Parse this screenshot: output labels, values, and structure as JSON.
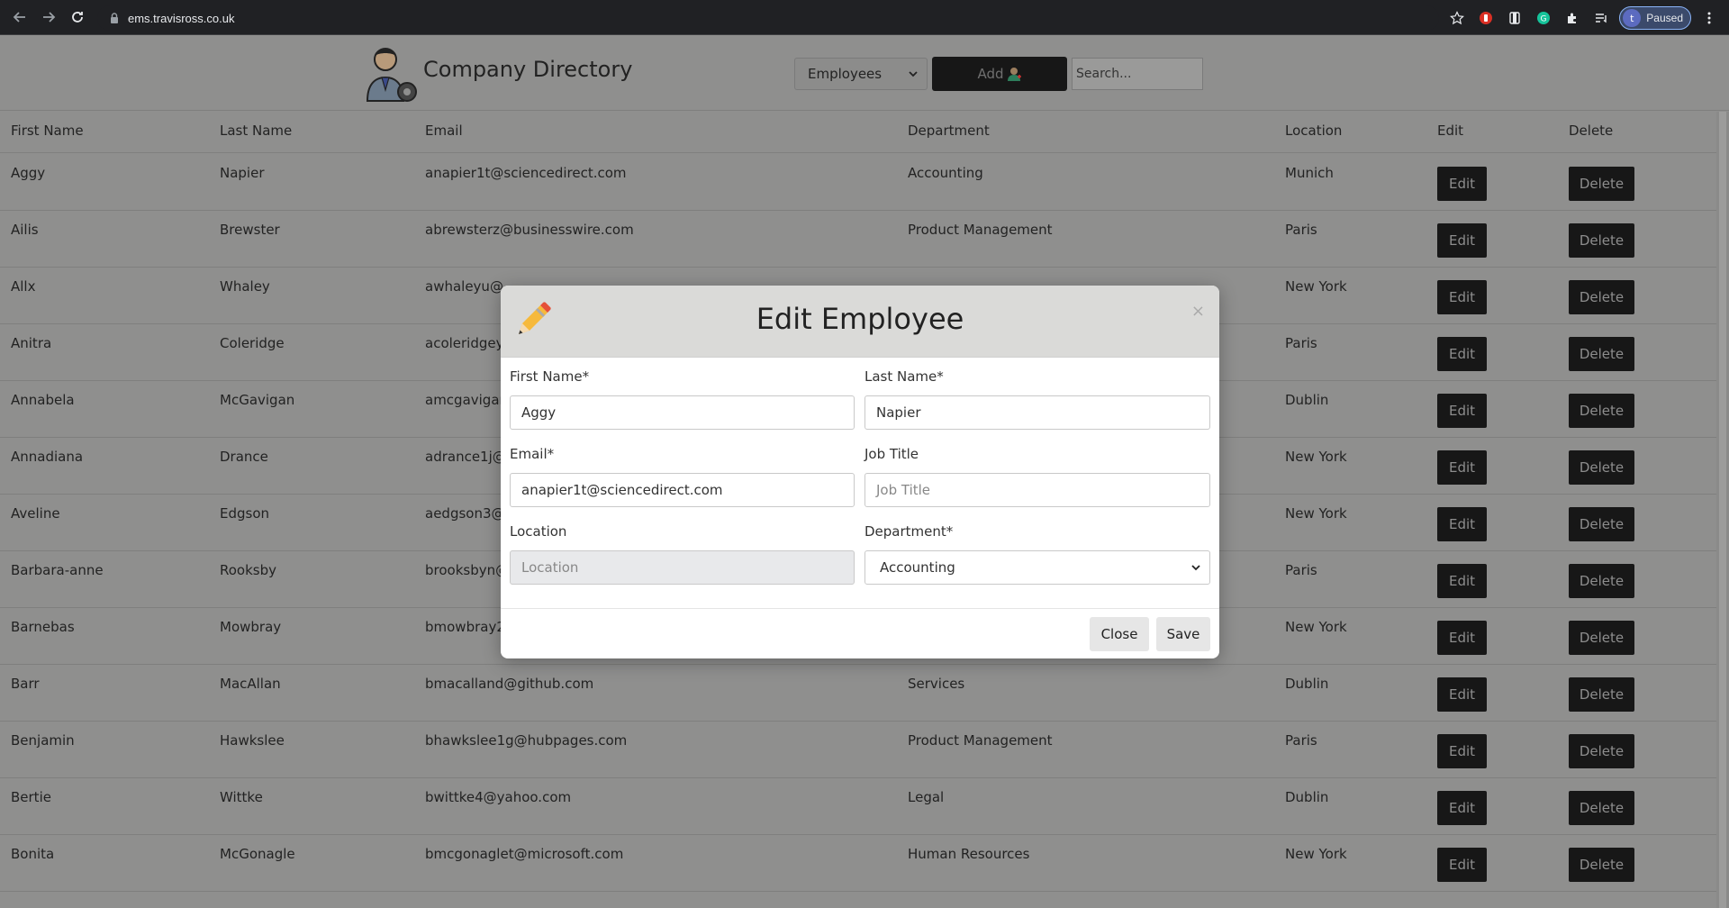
{
  "browser": {
    "url": "ems.travisross.co.uk",
    "profile_initial": "t",
    "profile_label": "Paused"
  },
  "header": {
    "brand": "Company Directory",
    "view_select": "Employees",
    "add_label": "Add",
    "search_placeholder": "Search..."
  },
  "table": {
    "columns": [
      "First Name",
      "Last Name",
      "Email",
      "Department",
      "Location",
      "Edit",
      "Delete"
    ],
    "edit_label": "Edit",
    "delete_label": "Delete",
    "rows": [
      {
        "first": "Aggy",
        "last": "Napier",
        "email": "anapier1t@sciencedirect.com",
        "department": "Accounting",
        "location": "Munich"
      },
      {
        "first": "Ailis",
        "last": "Brewster",
        "email": "abrewsterz@businesswire.com",
        "department": "Product Management",
        "location": "Paris"
      },
      {
        "first": "Allx",
        "last": "Whaley",
        "email": "awhaleyu@",
        "department": "",
        "location": "New York"
      },
      {
        "first": "Anitra",
        "last": "Coleridge",
        "email": "acoleridgey",
        "department": "",
        "location": "Paris"
      },
      {
        "first": "Annabela",
        "last": "McGavigan",
        "email": "amcgavigar",
        "department": "",
        "location": "Dublin"
      },
      {
        "first": "Annadiana",
        "last": "Drance",
        "email": "adrance1j@",
        "department": "",
        "location": "New York"
      },
      {
        "first": "Aveline",
        "last": "Edgson",
        "email": "aedgson3@",
        "department": "",
        "location": "New York"
      },
      {
        "first": "Barbara-anne",
        "last": "Rooksby",
        "email": "brooksbyn@",
        "department": "",
        "location": "Paris"
      },
      {
        "first": "Barnebas",
        "last": "Mowbray",
        "email": "bmowbray2",
        "department": "",
        "location": "New York"
      },
      {
        "first": "Barr",
        "last": "MacAllan",
        "email": "bmacalland@github.com",
        "department": "Services",
        "location": "Dublin"
      },
      {
        "first": "Benjamin",
        "last": "Hawkslee",
        "email": "bhawkslee1g@hubpages.com",
        "department": "Product Management",
        "location": "Paris"
      },
      {
        "first": "Bertie",
        "last": "Wittke",
        "email": "bwittke4@yahoo.com",
        "department": "Legal",
        "location": "Dublin"
      },
      {
        "first": "Bonita",
        "last": "McGonagle",
        "email": "bmcgonaglet@microsoft.com",
        "department": "Human Resources",
        "location": "New York"
      }
    ]
  },
  "modal": {
    "title": "Edit Employee",
    "close_glyph": "×",
    "first_name_label": "First Name*",
    "first_name_value": "Aggy",
    "last_name_label": "Last Name*",
    "last_name_value": "Napier",
    "email_label": "Email*",
    "email_value": "anapier1t@sciencedirect.com",
    "job_title_label": "Job Title",
    "job_title_placeholder": "Job Title",
    "location_label": "Location",
    "location_placeholder": "Location",
    "department_label": "Department*",
    "department_value": "Accounting",
    "close_button": "Close",
    "save_button": "Save"
  },
  "colors": {
    "overlay_bg": "#8f8f8e",
    "button_dark": "#171717",
    "modal_header": "#dadad8"
  }
}
